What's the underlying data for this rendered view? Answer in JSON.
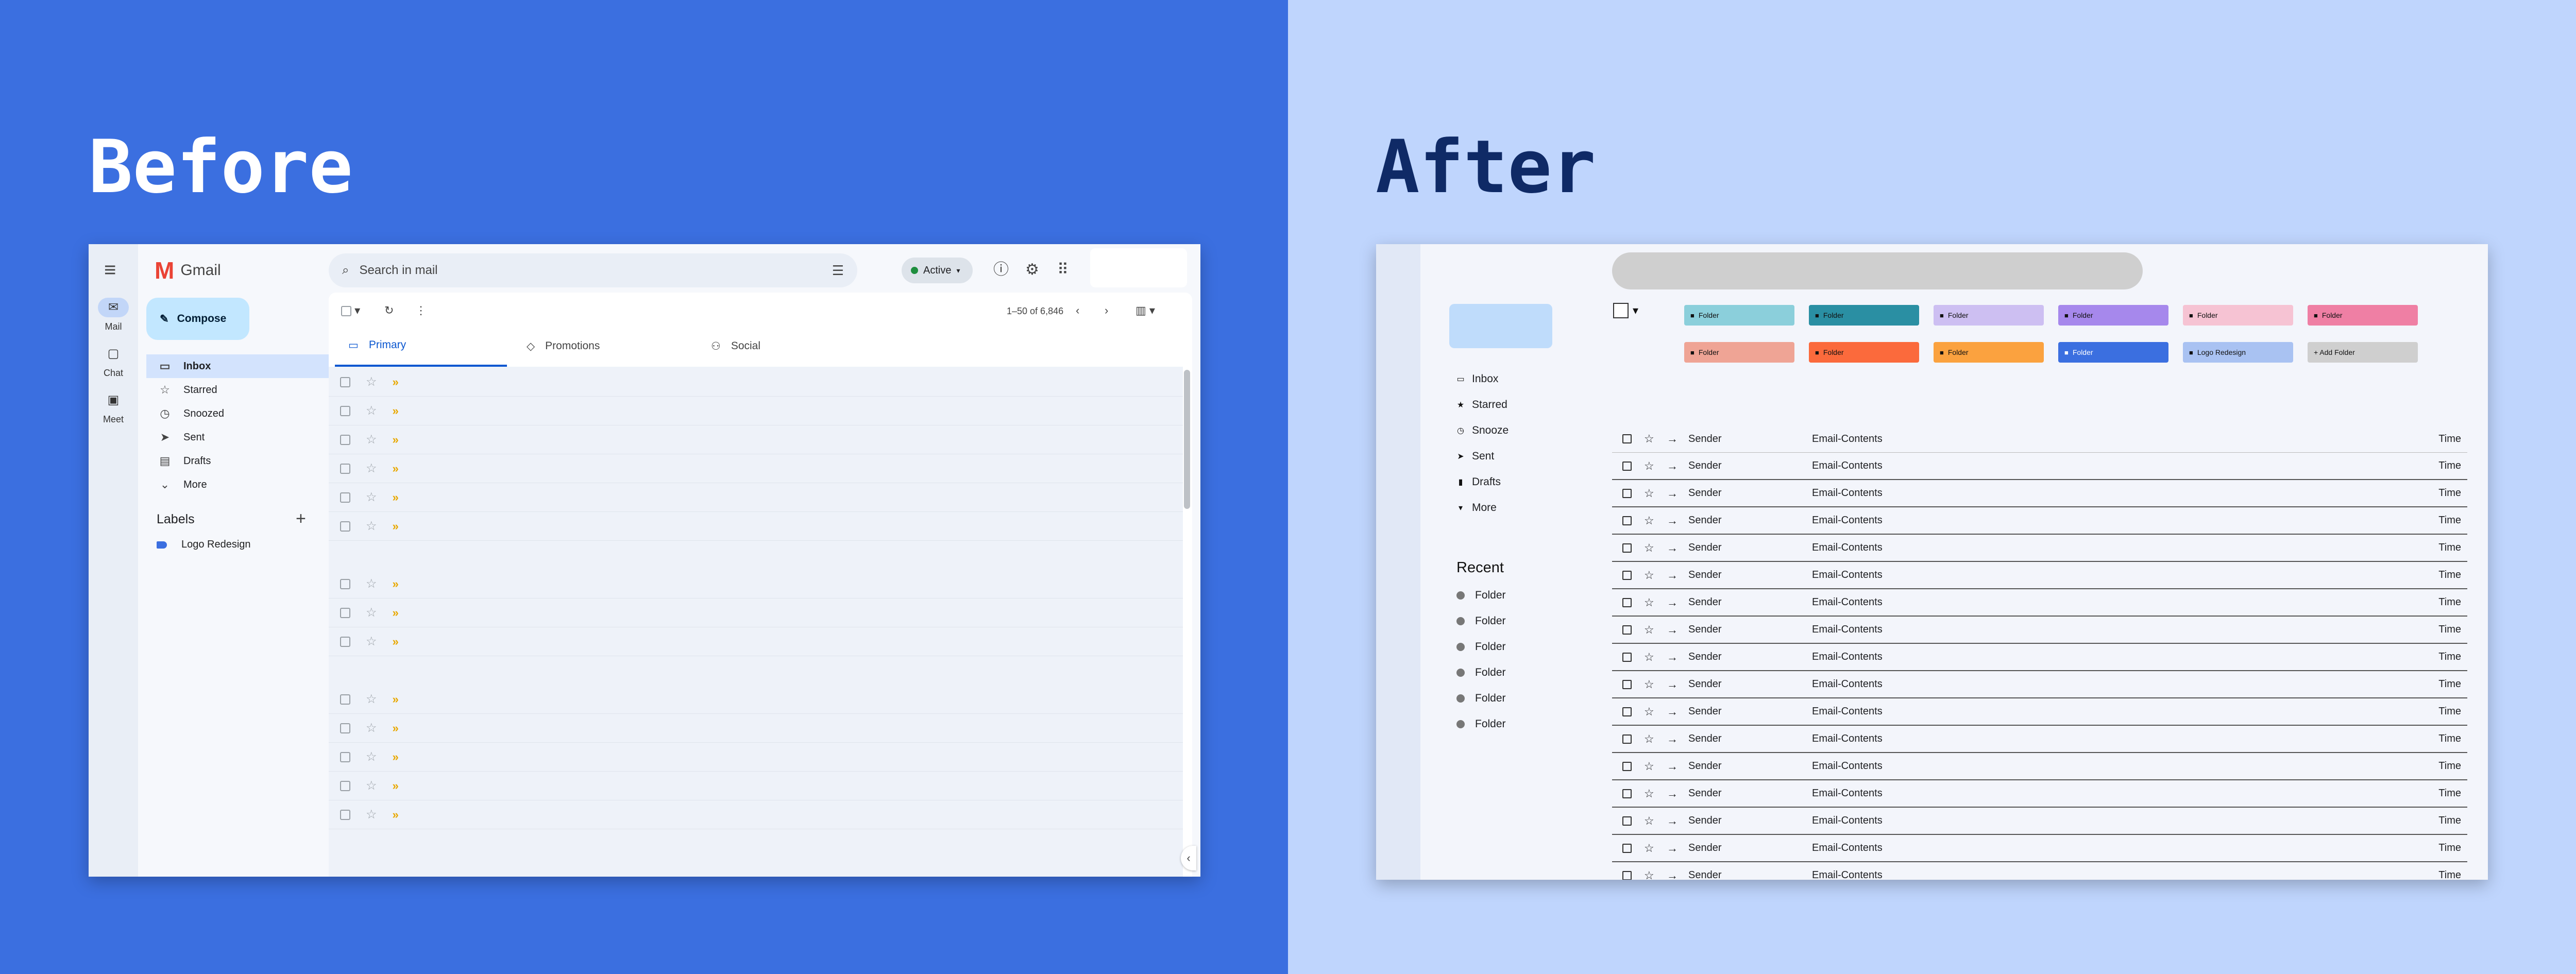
{
  "headings": {
    "before": "Before",
    "after": "After"
  },
  "colors": {
    "left_bg": "#3b6fe0",
    "right_bg": "#bfd5fd",
    "gmail_blue": "#0b57d0",
    "compose_bg": "#c2e7ff"
  },
  "before": {
    "rail": [
      {
        "icon": "mail-icon",
        "label": "Mail"
      },
      {
        "icon": "chat-icon",
        "label": "Chat"
      },
      {
        "icon": "meet-icon",
        "label": "Meet"
      }
    ],
    "app_name": "Gmail",
    "compose_label": "Compose",
    "nav": [
      {
        "icon": "inbox-icon",
        "label": "Inbox",
        "active": true
      },
      {
        "icon": "star-icon",
        "label": "Starred"
      },
      {
        "icon": "clock-icon",
        "label": "Snoozed"
      },
      {
        "icon": "send-icon",
        "label": "Sent"
      },
      {
        "icon": "draft-icon",
        "label": "Drafts"
      },
      {
        "icon": "chevron-down-icon",
        "label": "More"
      }
    ],
    "labels_title": "Labels",
    "labels": [
      {
        "label": "Logo Redesign",
        "color": "#3b6fe0"
      }
    ],
    "search_placeholder": "Search in mail",
    "status": "Active",
    "pagination": "1–50 of 6,846",
    "tabs": [
      {
        "icon": "inbox-icon",
        "label": "Primary",
        "active": true
      },
      {
        "icon": "tag-icon",
        "label": "Promotions"
      },
      {
        "icon": "people-icon",
        "label": "Social"
      }
    ],
    "email_rows": 14
  },
  "after": {
    "nav": [
      {
        "icon": "inbox-icon",
        "label": "Inbox"
      },
      {
        "icon": "star-icon",
        "label": "Starred"
      },
      {
        "icon": "clock-icon",
        "label": "Snooze"
      },
      {
        "icon": "send-icon",
        "label": "Sent"
      },
      {
        "icon": "draft-icon",
        "label": "Drafts"
      },
      {
        "icon": "chevron-down-icon",
        "label": "More"
      }
    ],
    "recent_title": "Recent",
    "recent": [
      "Folder",
      "Folder",
      "Folder",
      "Folder",
      "Folder",
      "Folder"
    ],
    "chips": [
      {
        "label": "Folder",
        "color": "#8bcfdb"
      },
      {
        "label": "Folder",
        "color": "#2a8fa3"
      },
      {
        "label": "Folder",
        "color": "#cdbff2"
      },
      {
        "label": "Folder",
        "color": "#a688ec"
      },
      {
        "label": "Folder",
        "color": "#f6c3d3"
      },
      {
        "label": "Folder",
        "color": "#ef7fa4"
      },
      {
        "label": "Folder",
        "color": "#efa495"
      },
      {
        "label": "Folder",
        "color": "#fb6a3c"
      },
      {
        "label": "Folder",
        "color": "#fba23f"
      },
      {
        "label": "Folder",
        "color": "#3b6fe0",
        "light": true
      },
      {
        "label": "Logo Redesign",
        "color": "#a9c2f2"
      },
      {
        "label": "+ Add Folder",
        "color": "#cfcfcf",
        "add": true
      }
    ],
    "row": {
      "sender": "Sender",
      "content": "Email-Contents",
      "time": "Time"
    },
    "email_rows": 17
  }
}
